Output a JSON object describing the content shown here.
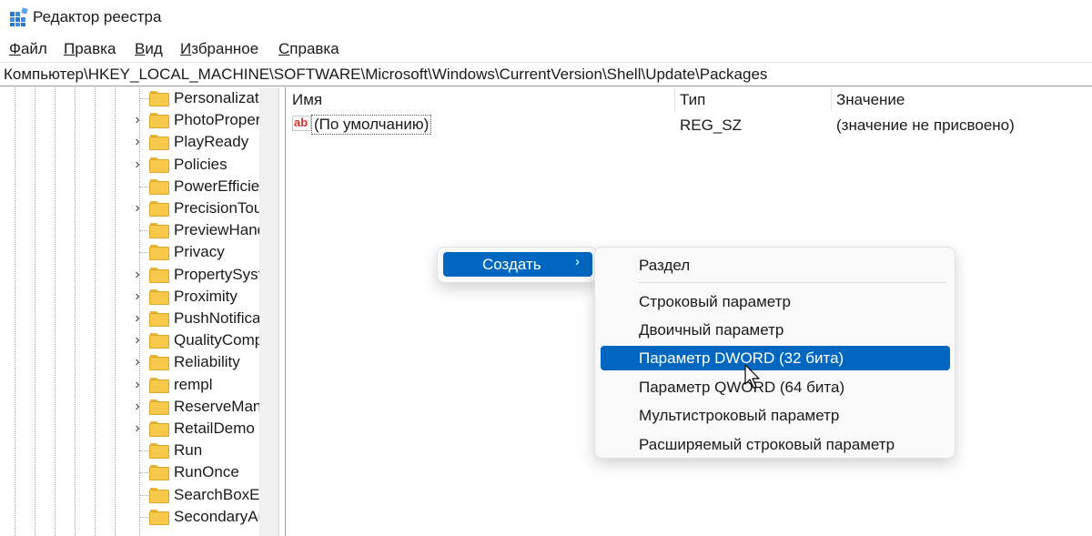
{
  "window": {
    "title": "Редактор реестра",
    "icon": "regedit-icon"
  },
  "menubar": [
    {
      "label": "Файл",
      "access_key": "Ф",
      "rest": "айл"
    },
    {
      "label": "Правка",
      "access_key": "П",
      "rest": "равка"
    },
    {
      "label": "Вид",
      "access_key": "В",
      "rest": "ид"
    },
    {
      "label": "Избранное",
      "access_key": "И",
      "rest": "збранное"
    },
    {
      "label": "Справка",
      "access_key": "С",
      "rest": "правка"
    }
  ],
  "address": "Компьютер\\HKEY_LOCAL_MACHINE\\SOFTWARE\\Microsoft\\Windows\\CurrentVersion\\Shell\\Update\\Packages",
  "tree": {
    "items": [
      {
        "label": "Personalizati",
        "expandable": false
      },
      {
        "label": "PhotoProper",
        "expandable": true
      },
      {
        "label": "PlayReady",
        "expandable": true
      },
      {
        "label": "Policies",
        "expandable": true
      },
      {
        "label": "PowerEfficie",
        "expandable": false
      },
      {
        "label": "PrecisionTou",
        "expandable": true
      },
      {
        "label": "PreviewHand",
        "expandable": false
      },
      {
        "label": "Privacy",
        "expandable": false
      },
      {
        "label": "PropertySyst",
        "expandable": true
      },
      {
        "label": "Proximity",
        "expandable": true
      },
      {
        "label": "PushNotifica",
        "expandable": true
      },
      {
        "label": "QualityComp",
        "expandable": true
      },
      {
        "label": "Reliability",
        "expandable": true
      },
      {
        "label": "rempl",
        "expandable": true
      },
      {
        "label": "ReserveMan",
        "expandable": true
      },
      {
        "label": "RetailDemo",
        "expandable": true
      },
      {
        "label": "Run",
        "expandable": false
      },
      {
        "label": "RunOnce",
        "expandable": false
      },
      {
        "label": "SearchBoxEv",
        "expandable": false
      },
      {
        "label": "SecondaryAu",
        "expandable": false
      }
    ]
  },
  "values": {
    "columns": {
      "name": "Имя",
      "type": "Тип",
      "data": "Значение"
    },
    "rows": [
      {
        "name": "(По умолчанию)",
        "type": "REG_SZ",
        "data": "(значение не присвоено)",
        "icon": "string-value-icon"
      }
    ]
  },
  "context_menu": {
    "create": {
      "label": "Создать",
      "arrow": "›"
    },
    "submenu": [
      {
        "label": "Раздел",
        "selected": false
      },
      {
        "label": "Строковый параметр",
        "selected": false
      },
      {
        "label": "Двоичный параметр",
        "selected": false
      },
      {
        "label": "Параметр DWORD (32 бита)",
        "selected": true
      },
      {
        "label": "Параметр QWORD (64 бита)",
        "selected": false
      },
      {
        "label": "Мультистроковый параметр",
        "selected": false
      },
      {
        "label": "Расширяемый строковый параметр",
        "selected": false
      }
    ]
  },
  "colors": {
    "accent": "#0067c0",
    "folder": "#f6c94a",
    "menu_bg": "#f9f9f9"
  }
}
